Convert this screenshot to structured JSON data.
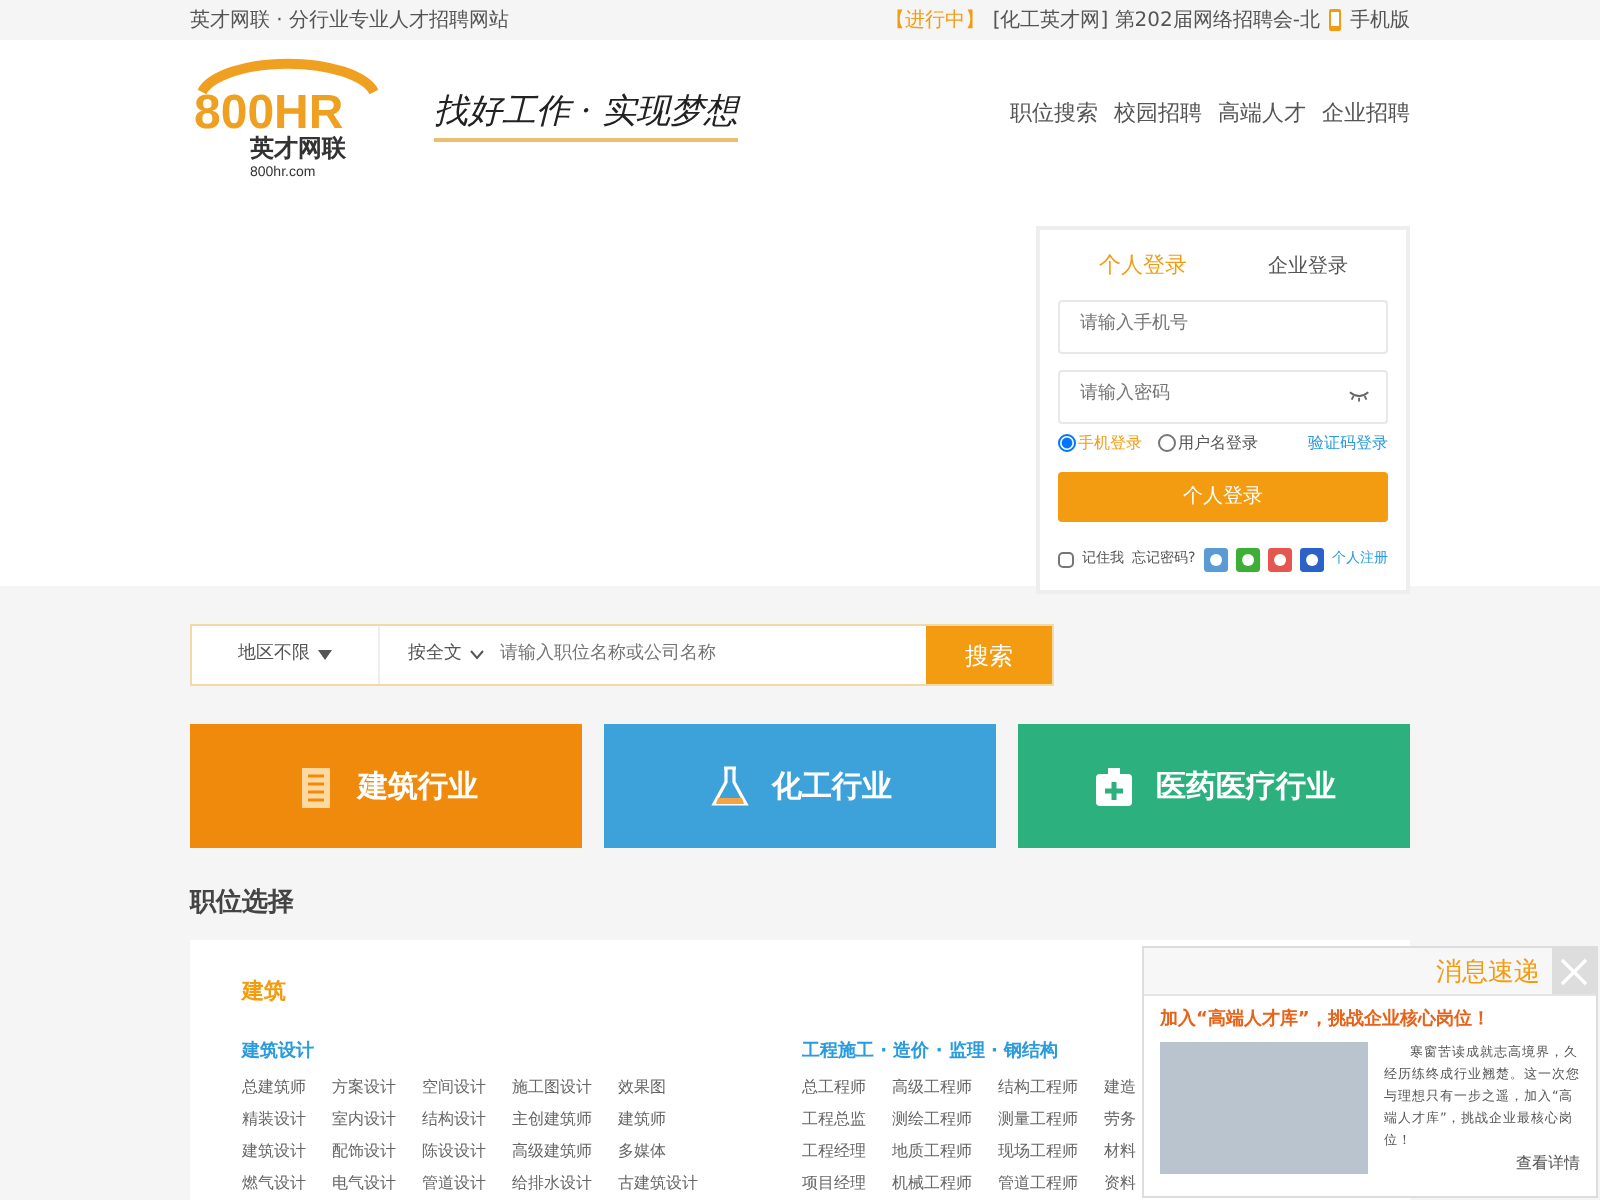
{
  "top_bar": {
    "site_text": "英才网联 · 分行业专业人才招聘网站",
    "notice_tag": "【进行中】",
    "notice_text": "[化工英才网] 第202届网络招聘会-北",
    "mobile": "手机版"
  },
  "header": {
    "logo": {
      "mark": "800HR",
      "name": "英才网联",
      "domain": "800hr.com"
    },
    "slogan": "找好工作 · 实现梦想",
    "nav": [
      "职位搜索",
      "校园招聘",
      "高端人才",
      "企业招聘"
    ]
  },
  "login": {
    "tabs": [
      {
        "label": "个人登录",
        "selected": true
      },
      {
        "label": "企业登录",
        "selected": false
      }
    ],
    "phone_placeholder": "请输入手机号",
    "password_placeholder": "请输入密码",
    "modes": [
      {
        "label": "手机登录",
        "selected": true
      },
      {
        "label": "用户名登录",
        "selected": false
      }
    ],
    "sms_link": "验证码登录",
    "submit": "个人登录",
    "remember": {
      "label": "记住我",
      "checked": false
    },
    "forgot": "忘记密码?",
    "register": "个人注册"
  },
  "search": {
    "region": "地区不限",
    "mode": "按全文",
    "placeholder": "请输入职位名称或公司名称",
    "button": "搜索"
  },
  "industries": [
    {
      "label": "建筑行业",
      "kind": "building",
      "color": "#f08a0c"
    },
    {
      "label": "化工行业",
      "kind": "flask",
      "color": "#3da2da"
    },
    {
      "label": "医药医疗行业",
      "kind": "medical",
      "color": "#2bb07e"
    }
  ],
  "section_title": "职位选择",
  "category": {
    "title": "建筑",
    "groups": [
      {
        "title": "建筑设计",
        "rows": [
          [
            "总建筑师",
            "方案设计",
            "空间设计",
            "施工图设计",
            "效果图"
          ],
          [
            "精装设计",
            "室内设计",
            "结构设计",
            "主创建筑师",
            "建筑师"
          ],
          [
            "建筑设计",
            "配饰设计",
            "陈设设计",
            "高级建筑师",
            "多媒体"
          ],
          [
            "燃气设计",
            "电气设计",
            "管道设计",
            "给排水设计",
            "古建筑设计"
          ]
        ]
      },
      {
        "title": "工程施工 · 造价 · 监理 · 钢结构",
        "rows": [
          [
            "总工程师",
            "高级工程师",
            "结构工程师",
            "建造"
          ],
          [
            "工程总监",
            "测绘工程师",
            "测量工程师",
            "劳务"
          ],
          [
            "工程经理",
            "地质工程师",
            "现场工程师",
            "材料"
          ],
          [
            "项目经理",
            "机械工程师",
            "管道工程师",
            "资料"
          ]
        ]
      }
    ]
  },
  "popup": {
    "title": "消息速递",
    "headline": "加入“高端人才库”，挑战企业核心岗位！",
    "body": "寒窗苦读成就志高境界，久经历练终成行业翘楚。这一次您与理想只有一步之遥，加入“高端人才库”，挑战企业最核心岗位！",
    "link": "查看详情"
  }
}
